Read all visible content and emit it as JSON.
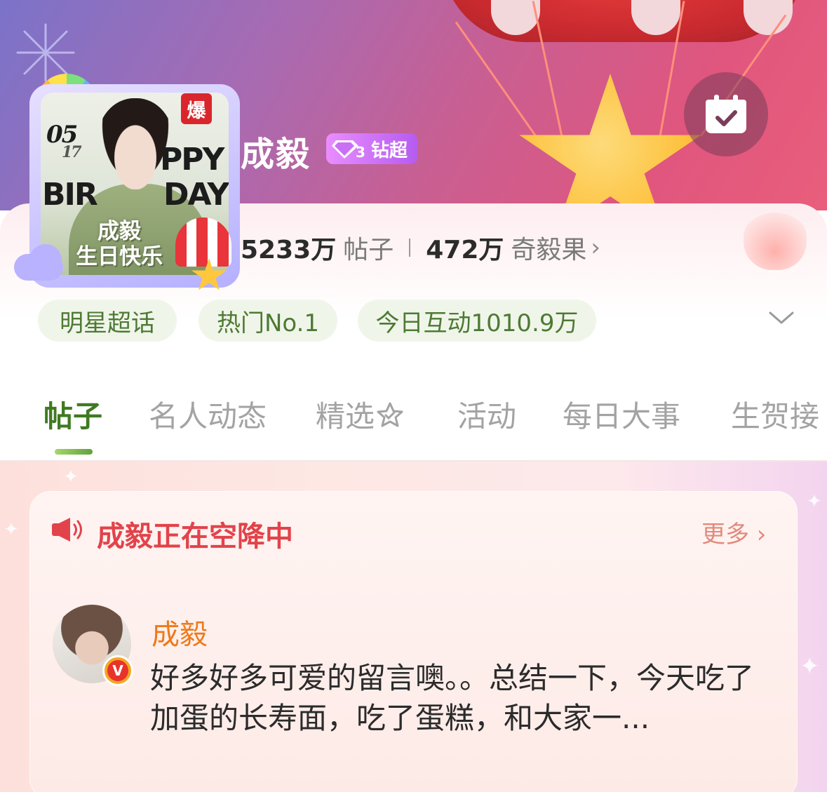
{
  "profile": {
    "name": "成毅",
    "level_badge": {
      "level": "3",
      "label": "钻超"
    },
    "avatar": {
      "hot_badge": "爆",
      "photo_text": {
        "date_top": "05",
        "date_bottom": "17",
        "line1": "PPY",
        "line2": "BIR",
        "line3": "DAY",
        "caption_line1": "成毅",
        "caption_line2": "生日快乐"
      }
    }
  },
  "stats": {
    "posts_count": "5233万",
    "posts_label": "帖子",
    "fans_count": "472万",
    "fans_label": "奇毅果"
  },
  "chips": [
    {
      "label": "明星超话"
    },
    {
      "label": "热门No.1"
    },
    {
      "label": "今日互动1010.9万"
    }
  ],
  "tabs": [
    {
      "label": "帖子",
      "active": true
    },
    {
      "label": "名人动态"
    },
    {
      "label": "精选"
    },
    {
      "label": "活动"
    },
    {
      "label": "每日大事"
    },
    {
      "label": "生贺接"
    }
  ],
  "airdrop": {
    "title": "成毅正在空降中",
    "more_label": "更多",
    "post": {
      "author": "成毅",
      "text": "好多好多可爱的留言噢。。总结一下，今天吃了加蛋的长寿面，吃了蛋糕，和大家一..."
    }
  },
  "colors": {
    "accent_green": "#3f7a22",
    "chip_text": "#4d7a33",
    "airdrop_red": "#e2434a",
    "author_orange": "#ee7a1b",
    "badge_purple": "#b55cf0"
  },
  "icons": {
    "calendar": "calendar-check-icon",
    "chevron": "chevron-down-icon",
    "speaker": "speaker-icon",
    "verified": "verified-icon"
  }
}
